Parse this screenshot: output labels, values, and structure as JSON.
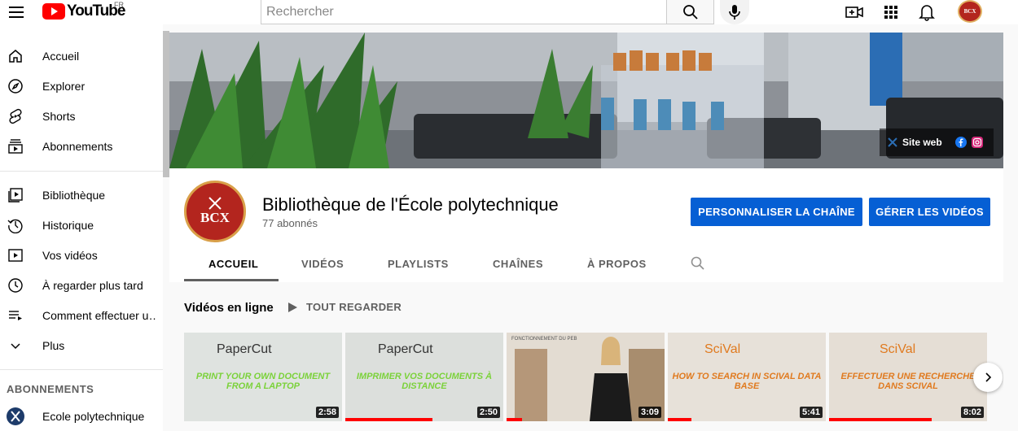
{
  "header": {
    "logo_text": "YouTube",
    "country": "FR",
    "search_placeholder": "Rechercher",
    "account_initials": "BCX"
  },
  "sidebar": {
    "main_items": [
      {
        "label": "Accueil",
        "icon": "home-icon"
      },
      {
        "label": "Explorer",
        "icon": "compass-icon"
      },
      {
        "label": "Shorts",
        "icon": "shorts-icon"
      },
      {
        "label": "Abonnements",
        "icon": "subscriptions-icon"
      }
    ],
    "library_items": [
      {
        "label": "Bibliothèque",
        "icon": "library-icon"
      },
      {
        "label": "Historique",
        "icon": "history-icon"
      },
      {
        "label": "Vos vidéos",
        "icon": "your-videos-icon"
      },
      {
        "label": "À regarder plus tard",
        "icon": "watch-later-icon"
      },
      {
        "label": "Comment effectuer u…",
        "icon": "playlist-icon"
      },
      {
        "label": "Plus",
        "icon": "chevron-down-icon"
      }
    ],
    "subscriptions_heading": "ABONNEMENTS",
    "subscriptions": [
      {
        "label": "Ecole polytechnique"
      }
    ]
  },
  "banner": {
    "site_link": "Site web",
    "social": [
      "facebook-icon",
      "instagram-icon"
    ]
  },
  "channel": {
    "name": "Bibliothèque de l'École polytechnique",
    "subscribers": "77 abonnés",
    "avatar_text": "BCX",
    "customize_button": "PERSONNALISER LA CHAÎNE",
    "manage_button": "GÉRER LES VIDÉOS",
    "tabs": [
      "ACCUEIL",
      "VIDÉOS",
      "PLAYLISTS",
      "CHAÎNES",
      "À PROPOS"
    ],
    "active_tab": "ACCUEIL"
  },
  "shelf": {
    "title": "Vidéos en ligne",
    "play_all": "TOUT REGARDER",
    "videos": [
      {
        "brand": "PaperCut",
        "caption": "PRINT YOUR OWN DOCUMENT FROM A LAPTOP",
        "duration": "2:58",
        "watched_fraction": 0,
        "caption_color": "#7bd23a"
      },
      {
        "brand": "PaperCut",
        "caption": "IMPRIMER VOS DOCUMENTS À DISTANCE",
        "duration": "2:50",
        "watched_fraction": 0.55,
        "caption_color": "#7bd23a"
      },
      {
        "brand": "",
        "caption": "FONCTIONNEMENT DU PEB",
        "duration": "3:09",
        "watched_fraction": 0.1,
        "caption_color": "#555555"
      },
      {
        "brand": "SciVal",
        "caption": "HOW TO SEARCH IN SCIVAL DATA BASE",
        "duration": "5:41",
        "watched_fraction": 0.15,
        "caption_color": "#e07a1f"
      },
      {
        "brand": "SciVal",
        "caption": "EFFECTUER UNE RECHERCHE DANS SCIVAL",
        "duration": "8:02",
        "watched_fraction": 0.65,
        "caption_color": "#e07a1f"
      }
    ]
  },
  "colors": {
    "brand_red": "#ff0000",
    "button_blue": "#065fd4",
    "avatar_red": "#b3251e"
  }
}
